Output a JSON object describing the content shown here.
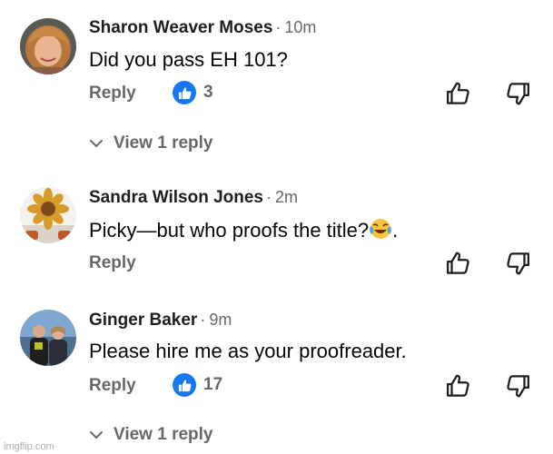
{
  "comments": [
    {
      "author": "Sharon Weaver Moses",
      "time": "10m",
      "text": "Did you pass EH 101?",
      "reply_label": "Reply",
      "reaction_count": "3",
      "view_replies": "View 1 reply"
    },
    {
      "author": "Sandra Wilson Jones",
      "time": "2m",
      "text": "Picky—but who proofs the title?",
      "text_suffix": ".",
      "emoji": "tears-of-joy",
      "reply_label": "Reply"
    },
    {
      "author": "Ginger Baker",
      "time": "9m",
      "text": "Please hire me as your proofreader.",
      "reply_label": "Reply",
      "reaction_count": "17",
      "view_replies": "View 1 reply"
    }
  ],
  "separator": "·",
  "watermark": "imgflip.com",
  "colors": {
    "reaction_blue": "#1877f2",
    "secondary_text": "#65676b"
  }
}
